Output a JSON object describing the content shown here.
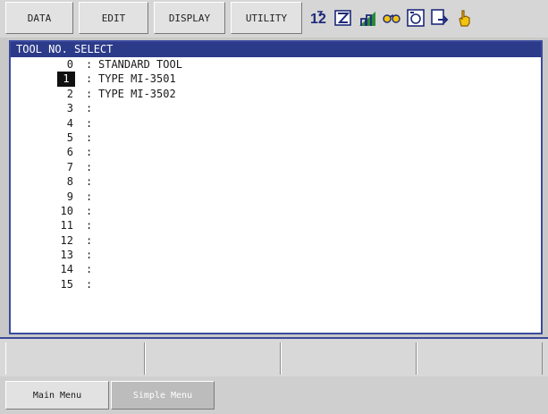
{
  "menu": {
    "data": "DATA",
    "edit": "EDIT",
    "display": "DISPLAY",
    "utility": "UTILITY"
  },
  "status_icons": [
    "one-two-icon",
    "edit-mode-icon",
    "chart-icon",
    "robot-icon",
    "teach-mode-icon",
    "arrow-icon",
    "hand-pointer-icon"
  ],
  "panel": {
    "title": "TOOL NO. SELECT",
    "rows": [
      {
        "num": "0",
        "sep": ":",
        "name": "STANDARD TOOL"
      },
      {
        "num": "1",
        "sep": ":",
        "name": "TYPE MI-3501"
      },
      {
        "num": "2",
        "sep": ":",
        "name": "TYPE MI-3502"
      },
      {
        "num": "3",
        "sep": ":",
        "name": ""
      },
      {
        "num": "4",
        "sep": ":",
        "name": ""
      },
      {
        "num": "5",
        "sep": ":",
        "name": ""
      },
      {
        "num": "6",
        "sep": ":",
        "name": ""
      },
      {
        "num": "7",
        "sep": ":",
        "name": ""
      },
      {
        "num": "8",
        "sep": ":",
        "name": ""
      },
      {
        "num": "9",
        "sep": ":",
        "name": ""
      },
      {
        "num": "10",
        "sep": ":",
        "name": ""
      },
      {
        "num": "11",
        "sep": ":",
        "name": ""
      },
      {
        "num": "12",
        "sep": ":",
        "name": ""
      },
      {
        "num": "13",
        "sep": ":",
        "name": ""
      },
      {
        "num": "14",
        "sep": ":",
        "name": ""
      },
      {
        "num": "15",
        "sep": ":",
        "name": ""
      }
    ]
  },
  "bottom": {
    "main_menu": "Main Menu",
    "simple_menu": "Simple Menu"
  },
  "colors": {
    "title_bar": "#2c3a8a",
    "panel_border": "#3b4a9e",
    "selected_bg": "#111111"
  }
}
